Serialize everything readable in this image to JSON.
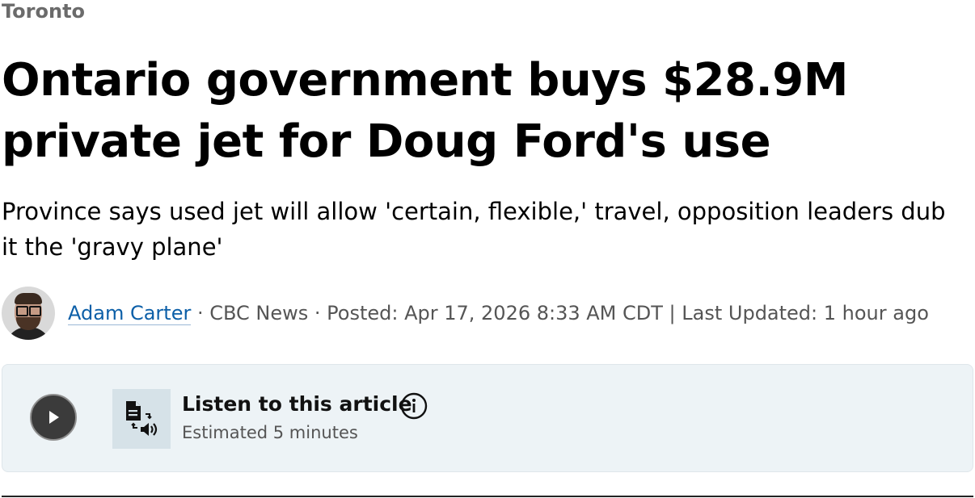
{
  "section": "Toronto",
  "headline": "Ontario government buys $28.9M private jet for Doug Ford's use",
  "dek": "Province says used jet will allow 'certain, flexible,' travel, opposition leaders dub it the 'gravy plane'",
  "byline": {
    "author": "Adam Carter",
    "sep1": " · ",
    "outlet": "CBC News",
    "sep2": " · ",
    "posted": "Posted: Apr 17, 2026 8:33 AM CDT",
    "sep3": " | ",
    "updated": "Last Updated: 1 hour ago"
  },
  "audio": {
    "title": "Listen to this article",
    "estimate": "Estimated 5 minutes",
    "play_icon": "play-icon",
    "tts_icon": "text-to-speech-icon",
    "info_icon": "info-icon"
  },
  "colors": {
    "link": "#0c5fa8",
    "section": "#6b6b6b",
    "player_bg": "#edf3f6"
  }
}
